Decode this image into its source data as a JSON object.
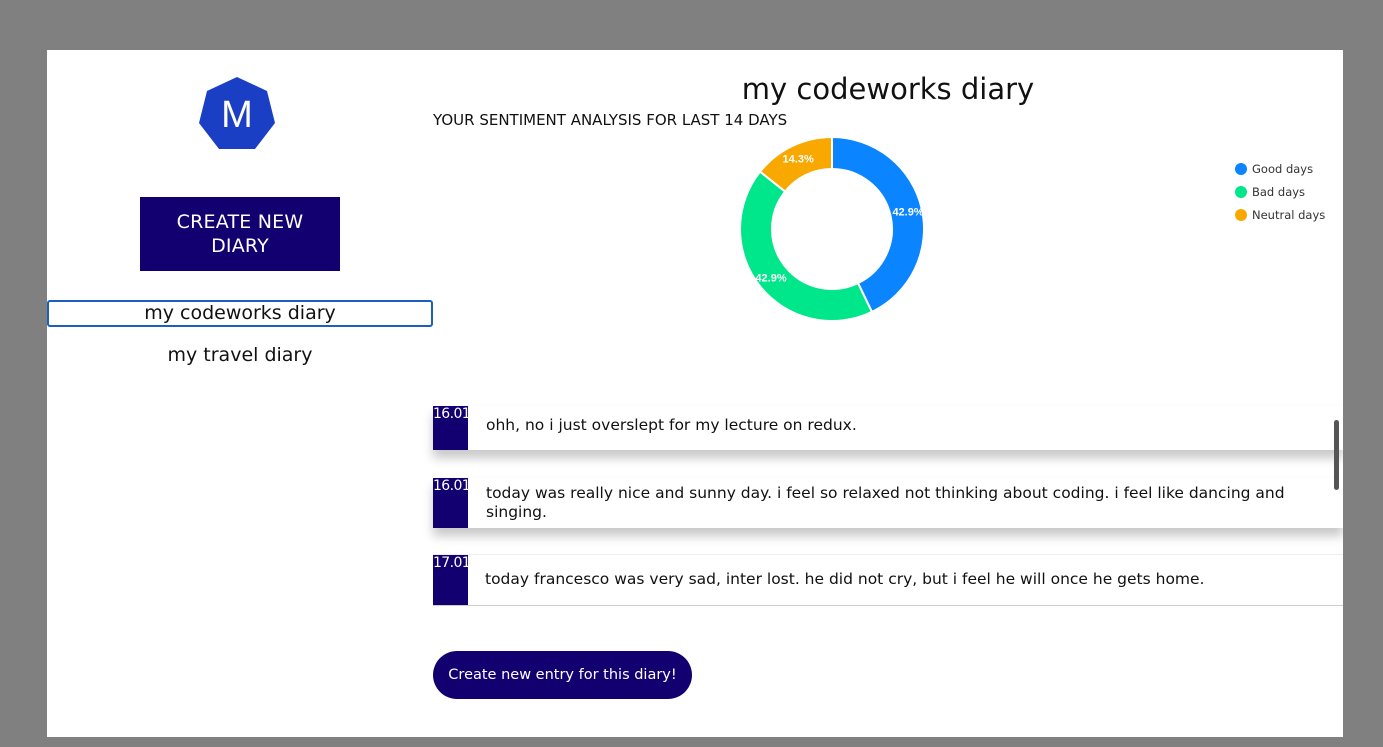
{
  "sidebar": {
    "logo_letter": "M",
    "create_diary_label": "CREATE NEW DIARY",
    "diaries": [
      {
        "label": "my codeworks diary",
        "selected": true
      },
      {
        "label": "my travel diary",
        "selected": false
      }
    ]
  },
  "main": {
    "title": "my codeworks diary",
    "sentiment_label": "YOUR SENTIMENT ANALYSIS FOR LAST 14 DAYS",
    "create_entry_label": "Create new entry for this diary!"
  },
  "chart_data": {
    "type": "pie",
    "donut": true,
    "title": "",
    "legend_position": "top-right",
    "series": [
      {
        "name": "Good days",
        "value": 42.9,
        "label": "42.9%",
        "color": "#0a84ff"
      },
      {
        "name": "Bad days",
        "value": 42.9,
        "label": "42.9%",
        "color": "#00e68a"
      },
      {
        "name": "Neutral days",
        "value": 14.3,
        "label": "14.3%",
        "color": "#f9a800"
      }
    ]
  },
  "entries": [
    {
      "date": "16.01",
      "text": "ohh, no i just overslept for my lecture on redux."
    },
    {
      "date": "16.01",
      "text": "today was really nice and sunny day. i feel so relaxed not thinking about coding. i feel like dancing and singing."
    },
    {
      "date": "17.01",
      "text": "today francesco was very sad, inter lost. he did not cry, but i feel he will once he gets home."
    }
  ],
  "colors": {
    "accent": "#120070",
    "overlay": "#808080",
    "selected_border": "#1d5fbf",
    "logo": "#1a3fc4"
  }
}
